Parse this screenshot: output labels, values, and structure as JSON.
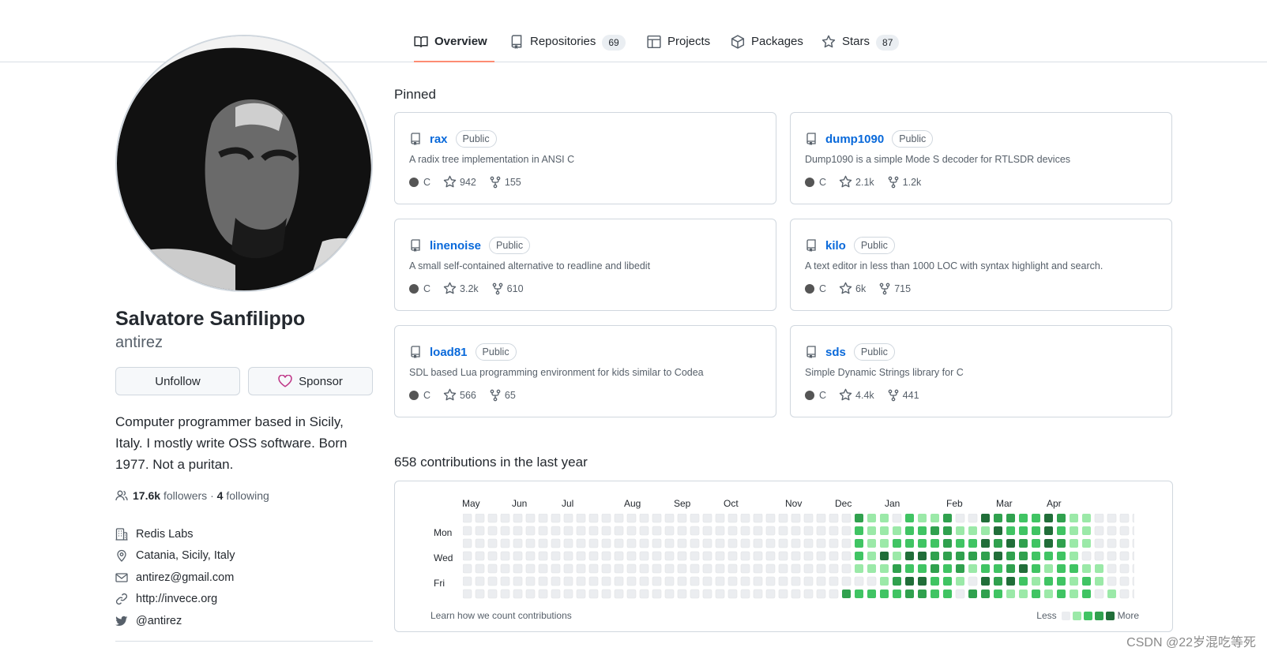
{
  "tabs": [
    {
      "label": "Overview",
      "icon": "book-icon",
      "active": true
    },
    {
      "label": "Repositories",
      "icon": "repo-icon",
      "count": "69"
    },
    {
      "label": "Projects",
      "icon": "table-icon"
    },
    {
      "label": "Packages",
      "icon": "package-icon"
    },
    {
      "label": "Stars",
      "icon": "star-icon",
      "count": "87"
    }
  ],
  "profile": {
    "name": "Salvatore Sanfilippo",
    "login": "antirez",
    "unfollow_label": "Unfollow",
    "sponsor_label": "Sponsor",
    "bio": "Computer programmer based in Sicily, Italy. I mostly write OSS software. Born 1977. Not a puritan.",
    "followers_count": "17.6k",
    "followers_label": "followers",
    "separator": "·",
    "following_count": "4",
    "following_label": "following",
    "company": "Redis Labs",
    "location": "Catania, Sicily, Italy",
    "email": "antirez@gmail.com",
    "website": "http://invece.org",
    "twitter": "@antirez"
  },
  "pinned": {
    "title": "Pinned",
    "cards": [
      {
        "name": "rax",
        "visibility": "Public",
        "desc": "A radix tree implementation in ANSI C",
        "lang": "C",
        "stars": "942",
        "forks": "155"
      },
      {
        "name": "dump1090",
        "visibility": "Public",
        "desc": "Dump1090 is a simple Mode S decoder for RTLSDR devices",
        "lang": "C",
        "stars": "2.1k",
        "forks": "1.2k"
      },
      {
        "name": "linenoise",
        "visibility": "Public",
        "desc": "A small self-contained alternative to readline and libedit",
        "lang": "C",
        "stars": "3.2k",
        "forks": "610"
      },
      {
        "name": "kilo",
        "visibility": "Public",
        "desc": "A text editor in less than 1000 LOC with syntax highlight and search.",
        "lang": "C",
        "stars": "6k",
        "forks": "715"
      },
      {
        "name": "load81",
        "visibility": "Public",
        "desc": "SDL based Lua programming environment for kids similar to Codea",
        "lang": "C",
        "stars": "566",
        "forks": "65"
      },
      {
        "name": "sds",
        "visibility": "Public",
        "desc": "Simple Dynamic Strings library for C",
        "lang": "C",
        "stars": "4.4k",
        "forks": "441"
      }
    ]
  },
  "contributions": {
    "title": "658 contributions in the last year",
    "months": [
      "May",
      "Jun",
      "Jul",
      "Aug",
      "Sep",
      "Oct",
      "Nov",
      "Dec",
      "Jan",
      "Feb",
      "Mar",
      "Apr"
    ],
    "days": [
      "Mon",
      "Wed",
      "Fri"
    ],
    "learn_label": "Learn how we count contributions",
    "less_label": "Less",
    "more_label": "More",
    "level_colors": [
      "#ebedf0",
      "#9be9a8",
      "#40c463",
      "#30a14e",
      "#216e39"
    ],
    "weeks": [
      "0000000",
      "0000000",
      "0000000",
      "0000000",
      "0000000",
      "0000000",
      "0000000",
      "0000000",
      "0000000",
      "0000000",
      "0000000",
      "0000000",
      "0000000",
      "0000000",
      "0000000",
      "0000000",
      "0000000",
      "0000000",
      "0000000",
      "0000000",
      "0000000",
      "0000000",
      "0000000",
      "0000000",
      "0000000",
      "0000000",
      "0000000",
      "0000000",
      "0000000",
      "0000000",
      "0000003",
      "3222102",
      "1111102",
      "1114112",
      "0121332",
      "2224243",
      "1224243",
      "1323322",
      "3333222",
      "0123310",
      "0123103",
      "4143243",
      "3434232",
      "3243341",
      "2233421",
      "2222212",
      "4442121",
      "3232222",
      "1111211",
      "1110122",
      "0000110",
      "0000001",
      "0000000",
      "0000000",
      "0000010",
      "0000000",
      "0000000"
    ]
  },
  "watermark": "CSDN @22岁混吃等死"
}
